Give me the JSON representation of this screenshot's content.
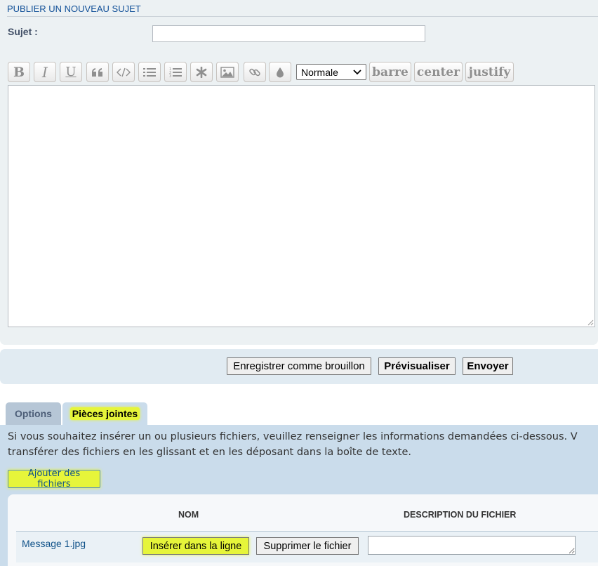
{
  "form": {
    "heading": "PUBLIER UN NOUVEAU SUJET",
    "subject_label": "Sujet :",
    "subject_value": ""
  },
  "toolbar": {
    "buttons": [
      {
        "name": "bold-icon",
        "label": "B"
      },
      {
        "name": "italic-icon",
        "label": "I"
      },
      {
        "name": "underline-icon",
        "label": "U"
      },
      {
        "name": "quote-icon"
      },
      {
        "name": "code-icon"
      },
      {
        "name": "bullet-list-icon"
      },
      {
        "name": "numbered-list-icon"
      },
      {
        "name": "asterisk-icon"
      },
      {
        "name": "image-icon"
      },
      {
        "name": "link-icon"
      },
      {
        "name": "color-drop-icon"
      }
    ],
    "font_size_selected": "Normale",
    "text_buttons": [
      "barre",
      "center",
      "justify"
    ]
  },
  "editor": {
    "value": ""
  },
  "actions": {
    "save_draft": "Enregistrer comme brouillon",
    "preview": "Prévisualiser",
    "submit": "Envoyer"
  },
  "tabs": {
    "options": "Options",
    "attachments": "Pièces jointes"
  },
  "attachments": {
    "instructions_line1": "Si vous souhaitez insérer un ou plusieurs fichiers, veuillez renseigner les informations demandées ci-dessous. V",
    "instructions_line2": "transférer des fichiers en les glissant et en les déposant dans la boîte de texte.",
    "add_files": "Ajouter des fichiers",
    "col_name": "NOM",
    "col_description": "DESCRIPTION DU FICHIER",
    "files": [
      {
        "filename": "Message 1.jpg",
        "insert_inline": "Insérer dans la ligne",
        "delete": "Supprimer le fichier",
        "description": ""
      }
    ]
  },
  "colors": {
    "heading": "#115098",
    "highlight": "#e6f53a",
    "panel_bg": "#ecf1f3",
    "attach_bg": "#cadceb"
  }
}
